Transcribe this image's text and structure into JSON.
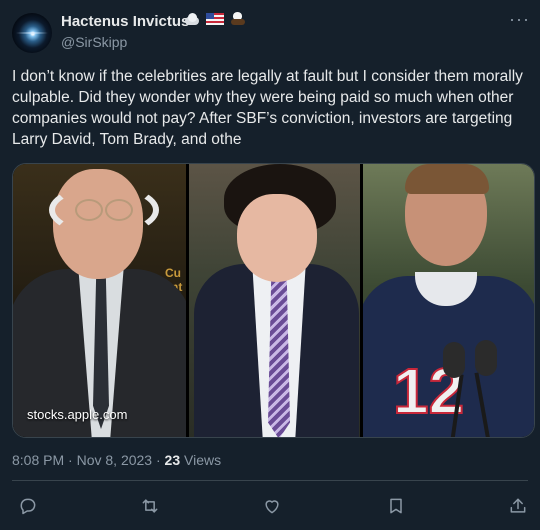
{
  "author": {
    "display_name": "Hactenus Invictus",
    "handle": "@SirSkipp",
    "badges": [
      "cloud-icon",
      "us-flag-icon",
      "eagle-icon"
    ]
  },
  "more_menu": "···",
  "tweet": {
    "text": "I don’t know if the celebrities are legally at fault but I consider them morally culpable. Did they wonder why they were being paid so much when other companies would not pay? After SBF’s conviction, investors are targeting Larry David, Tom Brady, and othe"
  },
  "media": {
    "watermark": "stocks.apple.com",
    "jersey_number": "12"
  },
  "meta": {
    "time": "8:08 PM",
    "separator1": " · ",
    "date": "Nov 8, 2023",
    "separator2": " · ",
    "views_count": "23",
    "views_label": " Views"
  },
  "actions": [
    "reply-icon",
    "retweet-icon",
    "like-icon",
    "bookmark-icon",
    "share-icon"
  ],
  "colors": {
    "background": "#15202b",
    "text_primary": "#e7e9ea",
    "text_secondary": "#8b98a5",
    "border": "#38444d"
  }
}
